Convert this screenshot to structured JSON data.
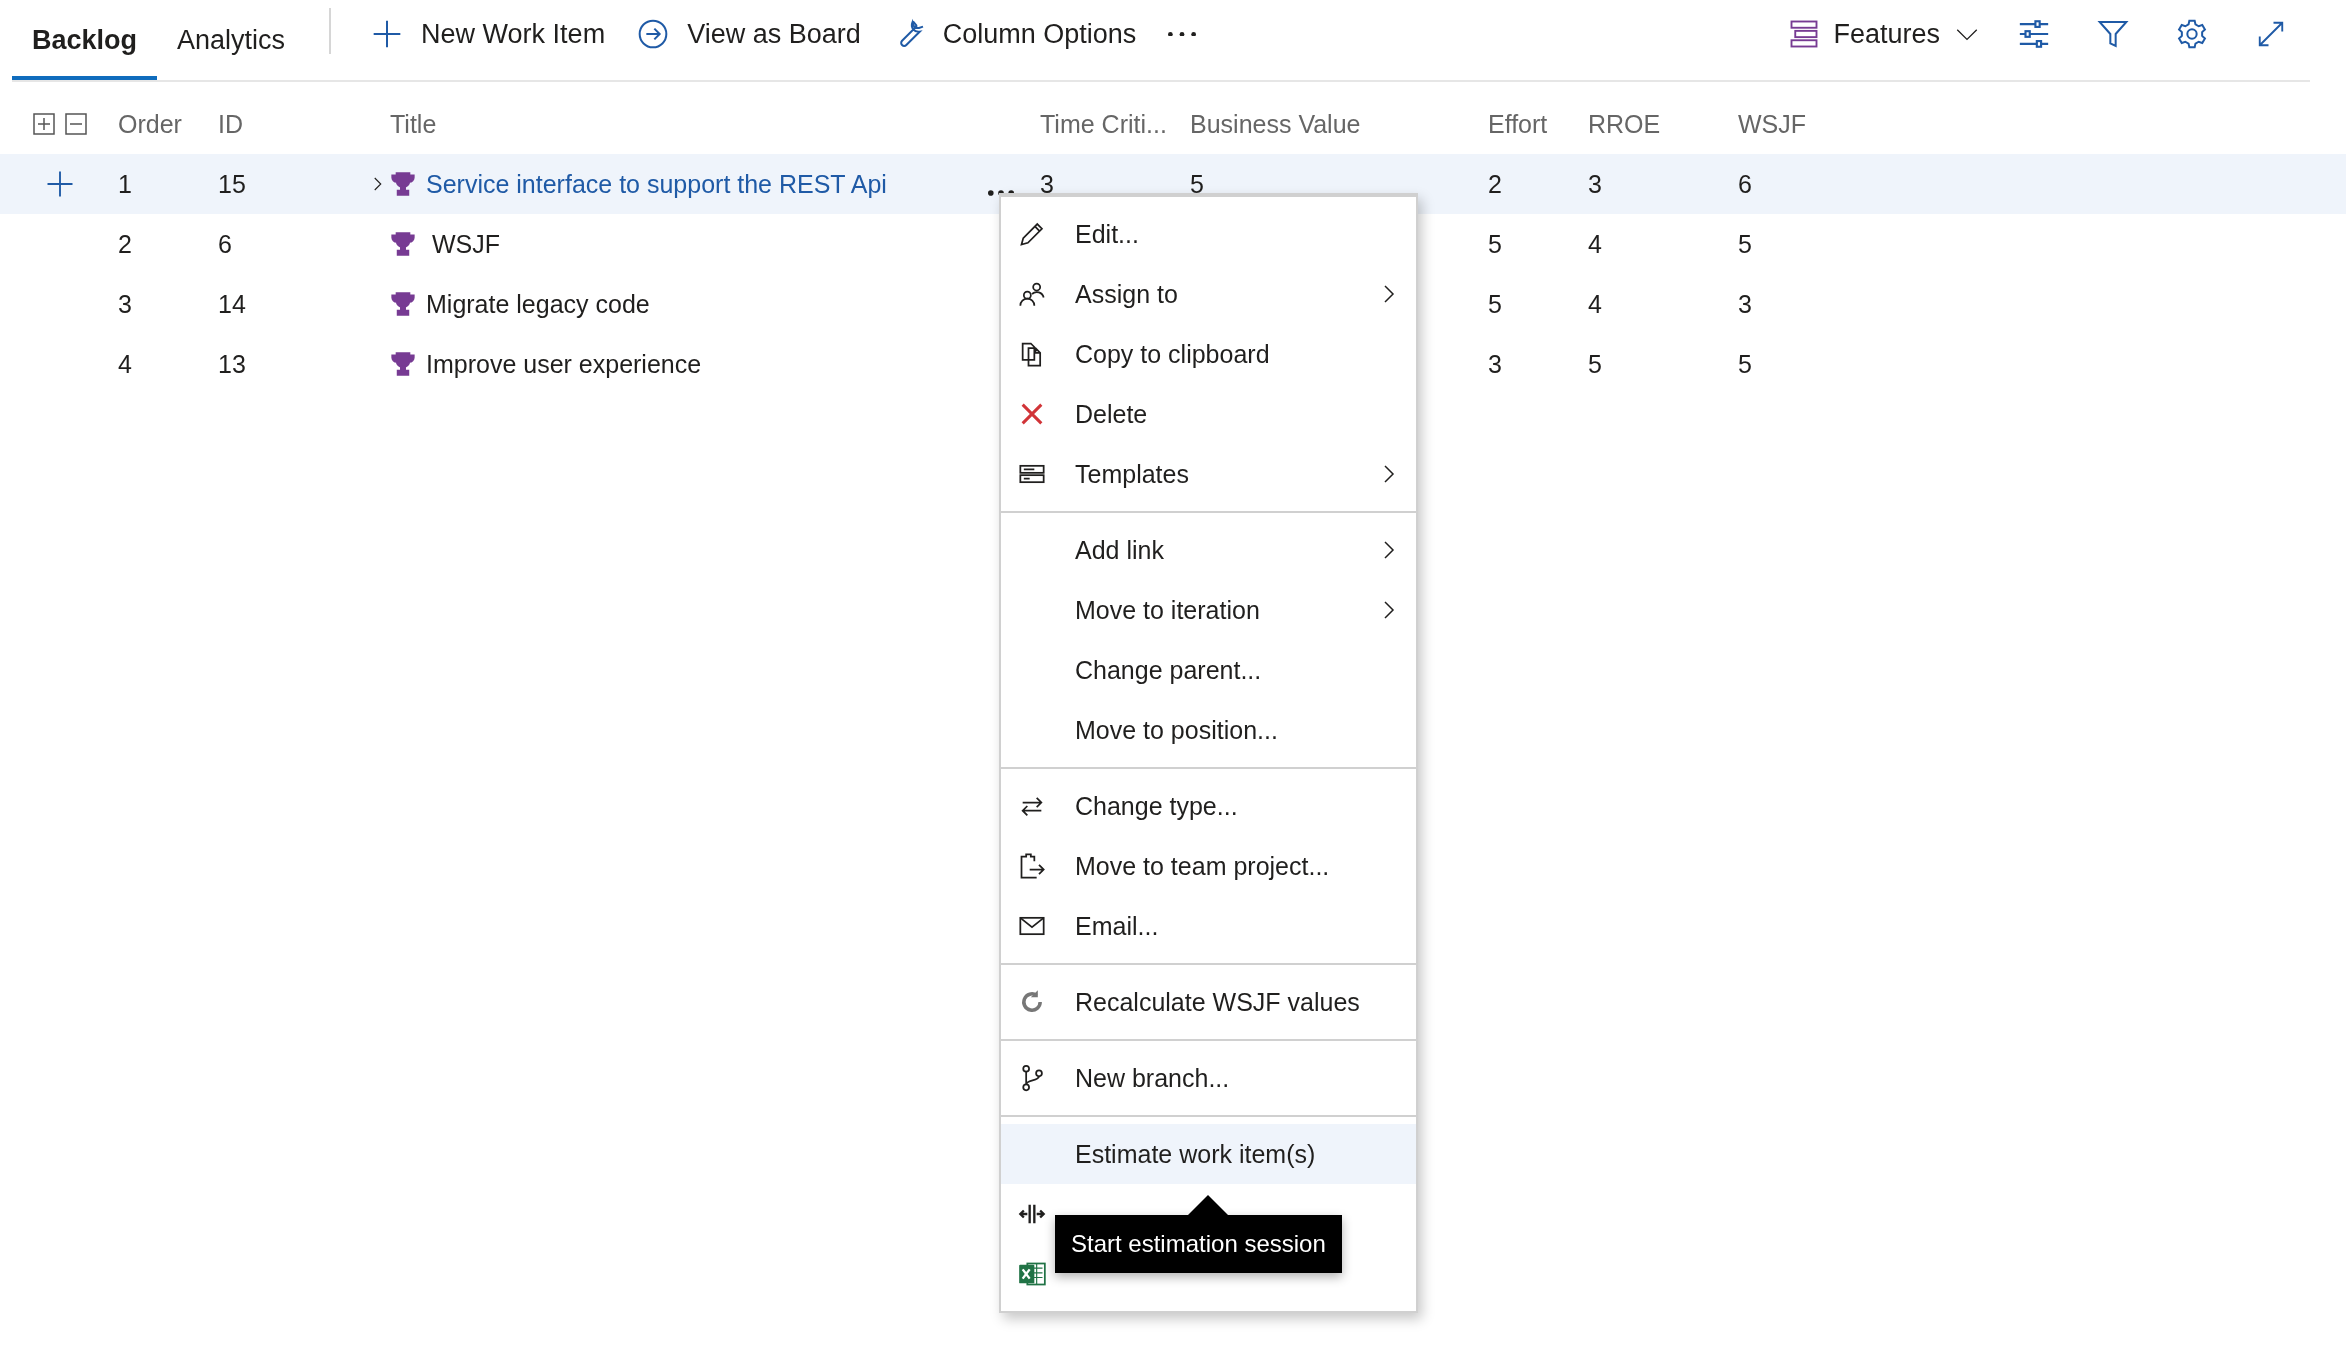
{
  "tabs": [
    {
      "label": "Backlog",
      "selected": true
    },
    {
      "label": "Analytics",
      "selected": false
    }
  ],
  "toolbar": {
    "actions": [
      {
        "kind": "add",
        "label": "New Work Item"
      },
      {
        "kind": "board",
        "label": "View as Board"
      },
      {
        "kind": "columns",
        "label": "Column Options"
      },
      {
        "kind": "more"
      }
    ],
    "level_picker": {
      "label": "Features"
    }
  },
  "table": {
    "columns": [
      "Order",
      "ID",
      "Title",
      "Time Criti...",
      "Business Value",
      "Effort",
      "RROE",
      "WSJF"
    ],
    "rows": [
      {
        "order": "1",
        "id": "15",
        "title": "Service interface to support the REST Api",
        "time_criticality": "3",
        "business_value": "5",
        "effort": "2",
        "rroe": "3",
        "wsjf": "6",
        "selected": true,
        "expanded": false
      },
      {
        "order": "2",
        "id": "6",
        "title": "WSJF",
        "effort": "5",
        "rroe": "4",
        "wsjf": "5",
        "selected": false
      },
      {
        "order": "3",
        "id": "14",
        "title": "Migrate legacy code",
        "effort": "5",
        "rroe": "4",
        "wsjf": "3",
        "selected": false
      },
      {
        "order": "4",
        "id": "13",
        "title": "Improve user experience",
        "effort": "3",
        "rroe": "5",
        "wsjf": "5",
        "selected": false
      }
    ]
  },
  "context_menu": {
    "groups": [
      [
        {
          "kind": "edit",
          "label": "Edit...",
          "submenu": false,
          "selected": false
        },
        {
          "kind": "assign",
          "label": "Assign to",
          "submenu": true,
          "selected": false
        },
        {
          "kind": "copy",
          "label": "Copy to clipboard",
          "submenu": false,
          "selected": false
        },
        {
          "kind": "delete",
          "label": "Delete",
          "submenu": false,
          "selected": false
        },
        {
          "kind": "templates",
          "label": "Templates",
          "submenu": true,
          "selected": false
        }
      ],
      [
        {
          "kind": "plain",
          "label": "Add link",
          "submenu": true,
          "selected": false
        },
        {
          "kind": "plain",
          "label": "Move to iteration",
          "submenu": true,
          "selected": false
        },
        {
          "kind": "plain",
          "label": "Change parent...",
          "submenu": false,
          "selected": false
        },
        {
          "kind": "plain",
          "label": "Move to position...",
          "submenu": false,
          "selected": false
        }
      ],
      [
        {
          "kind": "change_type",
          "label": "Change type...",
          "submenu": false,
          "selected": false
        },
        {
          "kind": "move_project",
          "label": "Move to team project...",
          "submenu": false,
          "selected": false
        },
        {
          "kind": "email",
          "label": "Email...",
          "submenu": false,
          "selected": false
        }
      ],
      [
        {
          "kind": "recalculate",
          "label": "Recalculate WSJF values",
          "submenu": false,
          "selected": false
        }
      ],
      [
        {
          "kind": "branch",
          "label": "New branch...",
          "submenu": false,
          "selected": false
        }
      ],
      [
        {
          "kind": "plain",
          "label": "Estimate work item(s)",
          "submenu": false,
          "selected": true
        },
        {
          "kind": "split",
          "submenu": false,
          "selected": false
        },
        {
          "kind": "excel",
          "submenu": false,
          "selected": false
        }
      ]
    ]
  },
  "tooltip": {
    "text": "Start estimation session"
  }
}
